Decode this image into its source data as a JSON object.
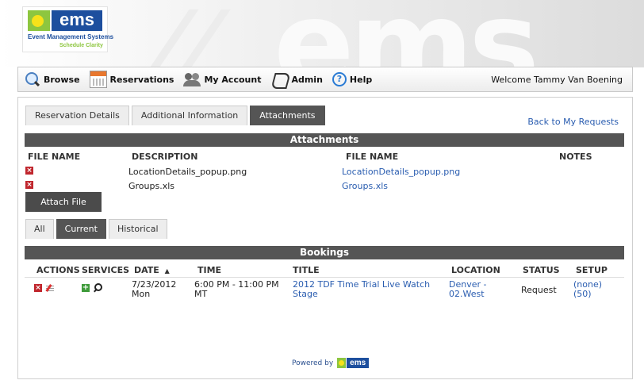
{
  "branding": {
    "logo_word": "ems",
    "logo_line1": "Event Management Systems",
    "logo_line2": "Schedule Clarity",
    "watermark": "ems",
    "brand_blue": "#1d4f9e",
    "brand_green": "#8dc63f"
  },
  "nav": {
    "items": [
      {
        "label": "Browse",
        "icon": "search-icon"
      },
      {
        "label": "Reservations",
        "icon": "calendar-icon"
      },
      {
        "label": "My Account",
        "icon": "users-icon"
      },
      {
        "label": "Admin",
        "icon": "pen-icon"
      },
      {
        "label": "Help",
        "icon": "help-icon"
      }
    ],
    "help_glyph": "?",
    "welcome": "Welcome Tammy Van Boening"
  },
  "tabs": [
    {
      "label": "Reservation Details",
      "active": false
    },
    {
      "label": "Additional Information",
      "active": false
    },
    {
      "label": "Attachments",
      "active": true
    }
  ],
  "back_link": "Back to My Requests",
  "attachments": {
    "title": "Attachments",
    "headers": {
      "file_name": "FILE NAME",
      "description": "DESCRIPTION",
      "file_name2": "FILE NAME",
      "notes": "NOTES"
    },
    "rows": [
      {
        "description": "LocationDetails_popup.png",
        "file_link": "LocationDetails_popup.png",
        "notes": ""
      },
      {
        "description": "Groups.xls",
        "file_link": "Groups.xls",
        "notes": ""
      }
    ],
    "delete_glyph": "×",
    "attach_button": "Attach File"
  },
  "booking_tabs": [
    {
      "label": "All",
      "active": false
    },
    {
      "label": "Current",
      "active": true
    },
    {
      "label": "Historical",
      "active": false
    }
  ],
  "bookings": {
    "title": "Bookings",
    "headers": {
      "actions": "ACTIONS",
      "services": "SERVICES",
      "date": "DATE",
      "sort_glyph": "▲",
      "time": "TIME",
      "title": "TITLE",
      "location": "LOCATION",
      "status": "STATUS",
      "setup": "SETUP"
    },
    "rows": [
      {
        "date_line1": "7/23/2012",
        "date_line2": "Mon",
        "time_line1": "6:00 PM - 11:00 PM",
        "time_line2": "MT",
        "title_line1": "2012 TDF Time Trial Live Watch",
        "title_line2": "Stage",
        "location_line1": "Denver -",
        "location_line2": "02.West",
        "status": "Request",
        "setup_line1": "(none)",
        "setup_line2": "(50)"
      }
    ],
    "add_glyph": "+"
  },
  "footer": {
    "powered_by": "Powered by",
    "logo_word": "ems"
  }
}
